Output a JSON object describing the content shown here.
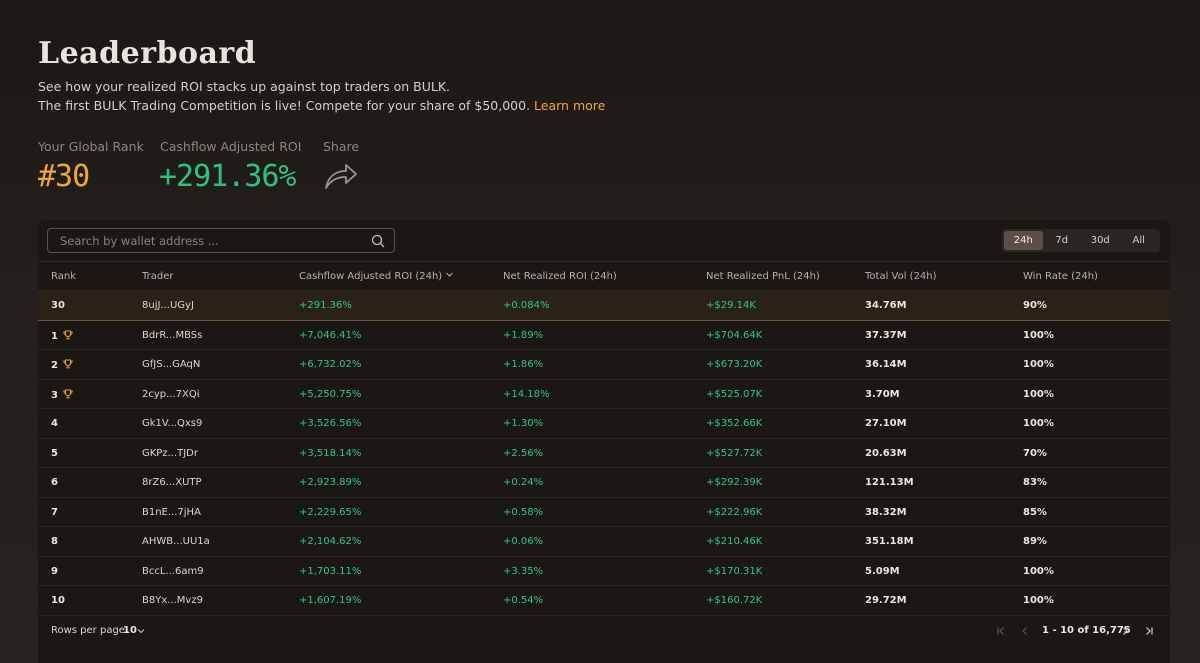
{
  "header": {
    "title": "Leaderboard",
    "subtitle_line1": "See how your realized ROI stacks up against top traders on BULK.",
    "subtitle_line2": "The first BULK Trading Competition is live! Compete for your share of $50,000.",
    "learn_more": "Learn more"
  },
  "stats": {
    "rank_label": "Your Global Rank",
    "rank_value": "#30",
    "roi_label": "Cashflow Adjusted ROI",
    "roi_value": "+291.36%",
    "share_label": "Share",
    "share_icon": "share-arrow-icon"
  },
  "search": {
    "placeholder": "Search by wallet address ..."
  },
  "periods": [
    {
      "label": "24h",
      "active": true
    },
    {
      "label": "7d",
      "active": false
    },
    {
      "label": "30d",
      "active": false
    },
    {
      "label": "All",
      "active": false
    }
  ],
  "columns": [
    "Rank",
    "Trader",
    "Cashflow Adjusted ROI (24h)",
    "Net Realized ROI (24h)",
    "Net Realized PnL (24h)",
    "Total Vol (24h)",
    "Win Rate (24h)"
  ],
  "my_row": {
    "rank": "30",
    "trader": "8ujJ...UGyJ",
    "roi": "+291.36%",
    "net_roi": "+0.084%",
    "pnl": "+$29.14K",
    "vol": "34.76M",
    "win": "90%"
  },
  "rows": [
    {
      "rank": "1",
      "trophy": true,
      "trader": "BdrR...MBSs",
      "roi": "+7,046.41%",
      "net_roi": "+1.89%",
      "pnl": "+$704.64K",
      "vol": "37.37M",
      "win": "100%"
    },
    {
      "rank": "2",
      "trophy": true,
      "trader": "GfJS...GAqN",
      "roi": "+6,732.02%",
      "net_roi": "+1.86%",
      "pnl": "+$673.20K",
      "vol": "36.14M",
      "win": "100%"
    },
    {
      "rank": "3",
      "trophy": true,
      "trader": "2cyp...7XQi",
      "roi": "+5,250.75%",
      "net_roi": "+14.18%",
      "pnl": "+$525.07K",
      "vol": "3.70M",
      "win": "100%"
    },
    {
      "rank": "4",
      "trophy": false,
      "trader": "Gk1V...Qxs9",
      "roi": "+3,526.56%",
      "net_roi": "+1.30%",
      "pnl": "+$352.66K",
      "vol": "27.10M",
      "win": "100%"
    },
    {
      "rank": "5",
      "trophy": false,
      "trader": "GKPz...TJDr",
      "roi": "+3,518.14%",
      "net_roi": "+2.56%",
      "pnl": "+$527.72K",
      "vol": "20.63M",
      "win": "70%"
    },
    {
      "rank": "6",
      "trophy": false,
      "trader": "8rZ6...XUTP",
      "roi": "+2,923.89%",
      "net_roi": "+0.24%",
      "pnl": "+$292.39K",
      "vol": "121.13M",
      "win": "83%"
    },
    {
      "rank": "7",
      "trophy": false,
      "trader": "B1nE...7jHA",
      "roi": "+2,229.65%",
      "net_roi": "+0.58%",
      "pnl": "+$222.96K",
      "vol": "38.32M",
      "win": "85%"
    },
    {
      "rank": "8",
      "trophy": false,
      "trader": "AHWB...UU1a",
      "roi": "+2,104.62%",
      "net_roi": "+0.06%",
      "pnl": "+$210.46K",
      "vol": "351.18M",
      "win": "89%"
    },
    {
      "rank": "9",
      "trophy": false,
      "trader": "BccL...6am9",
      "roi": "+1,703.11%",
      "net_roi": "+3.35%",
      "pnl": "+$170.31K",
      "vol": "5.09M",
      "win": "100%"
    },
    {
      "rank": "10",
      "trophy": false,
      "trader": "B8Yx...Mvz9",
      "roi": "+1,607.19%",
      "net_roi": "+0.54%",
      "pnl": "+$160.72K",
      "vol": "29.72M",
      "win": "100%"
    }
  ],
  "footer": {
    "rows_per_page_label": "Rows per page",
    "rows_per_page_value": "10",
    "range": "1 - 10 of 16,775"
  },
  "colors": {
    "accent": "#f0a640",
    "positive": "#35c585",
    "background": "#1d1a17"
  }
}
